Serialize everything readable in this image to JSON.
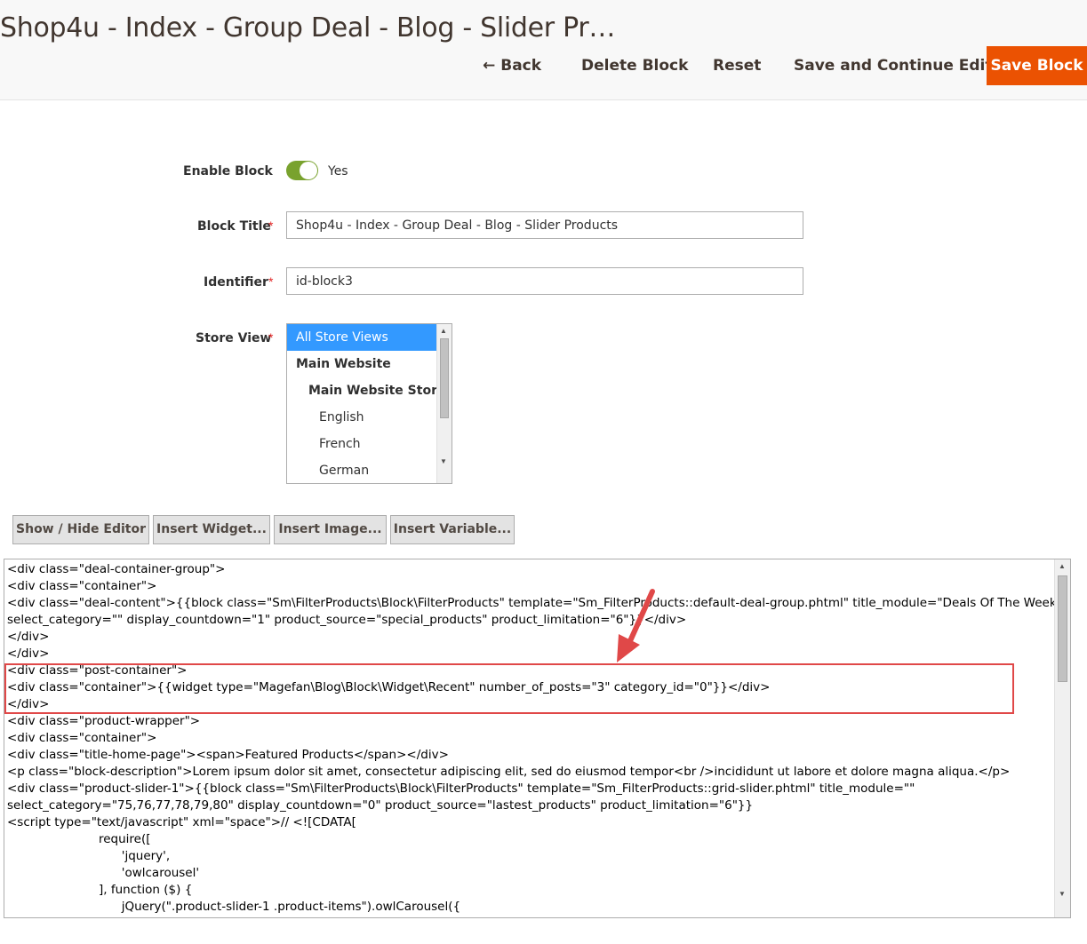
{
  "header": {
    "title": "Shop4u - Index - Group Deal - Blog - Slider Pr…",
    "actions": {
      "back": "Back",
      "delete": "Delete Block",
      "reset": "Reset",
      "save_continue": "Save and Continue Edit",
      "save": "Save Block"
    }
  },
  "form": {
    "enable_block": {
      "label": "Enable Block",
      "value": "Yes",
      "enabled": true
    },
    "block_title": {
      "label": "Block Title",
      "value": "Shop4u - Index - Group Deal - Blog - Slider Products"
    },
    "identifier": {
      "label": "Identifier",
      "value": "id-block3"
    },
    "store_view": {
      "label": "Store View",
      "options": [
        {
          "label": "All Store Views",
          "selected": true
        },
        {
          "label": "Main Website",
          "selected": false
        },
        {
          "label": "Main Website Store",
          "selected": false
        },
        {
          "label": "English",
          "selected": false
        },
        {
          "label": "French",
          "selected": false
        },
        {
          "label": "German",
          "selected": false
        }
      ]
    },
    "required_mark": "*"
  },
  "editor_buttons": [
    "Show / Hide Editor",
    "Insert Widget...",
    "Insert Image...",
    "Insert Variable..."
  ],
  "editor": {
    "lines": [
      "<div class=\"deal-container-group\">",
      "<div class=\"container\">",
      "<div class=\"deal-content\">{{block class=\"Sm\\FilterProducts\\Block\\FilterProducts\" template=\"Sm_FilterProducts::default-deal-group.phtml\" title_module=\"Deals Of The Week\"",
      "select_category=\"\" display_countdown=\"1\" product_source=\"special_products\" product_limitation=\"6\"}}</div>",
      "</div>",
      "</div>",
      "<div class=\"post-container\">",
      "<div class=\"container\">{{widget type=\"Magefan\\Blog\\Block\\Widget\\Recent\" number_of_posts=\"3\" category_id=\"0\"}}</div>",
      "</div>",
      "<div class=\"product-wrapper\">",
      "<div class=\"container\">",
      "<div class=\"title-home-page\"><span>Featured Products</span></div>",
      "<p class=\"block-description\">Lorem ipsum dolor sit amet, consectetur adipiscing elit, sed do eiusmod tempor<br />incididunt ut labore et dolore magna aliqua.</p>",
      "<div class=\"product-slider-1\">{{block class=\"Sm\\FilterProducts\\Block\\FilterProducts\" template=\"Sm_FilterProducts::grid-slider.phtml\" title_module=\"\"",
      "select_category=\"75,76,77,78,79,80\" display_countdown=\"0\" product_source=\"lastest_products\" product_limitation=\"6\"}}",
      "<script type=\"text/javascript\" xml=\"space\">// <![CDATA[",
      "                        require([",
      "                              'jquery',",
      "                              'owlcarousel'",
      "                        ], function ($) {",
      "                              jQuery(\".product-slider-1 .product-items\").owlCarousel({"
    ]
  },
  "colors": {
    "accent": "#eb5202",
    "toggle_on": "#79a22e",
    "highlight": "#e04848",
    "selected_option": "#3399ff"
  }
}
